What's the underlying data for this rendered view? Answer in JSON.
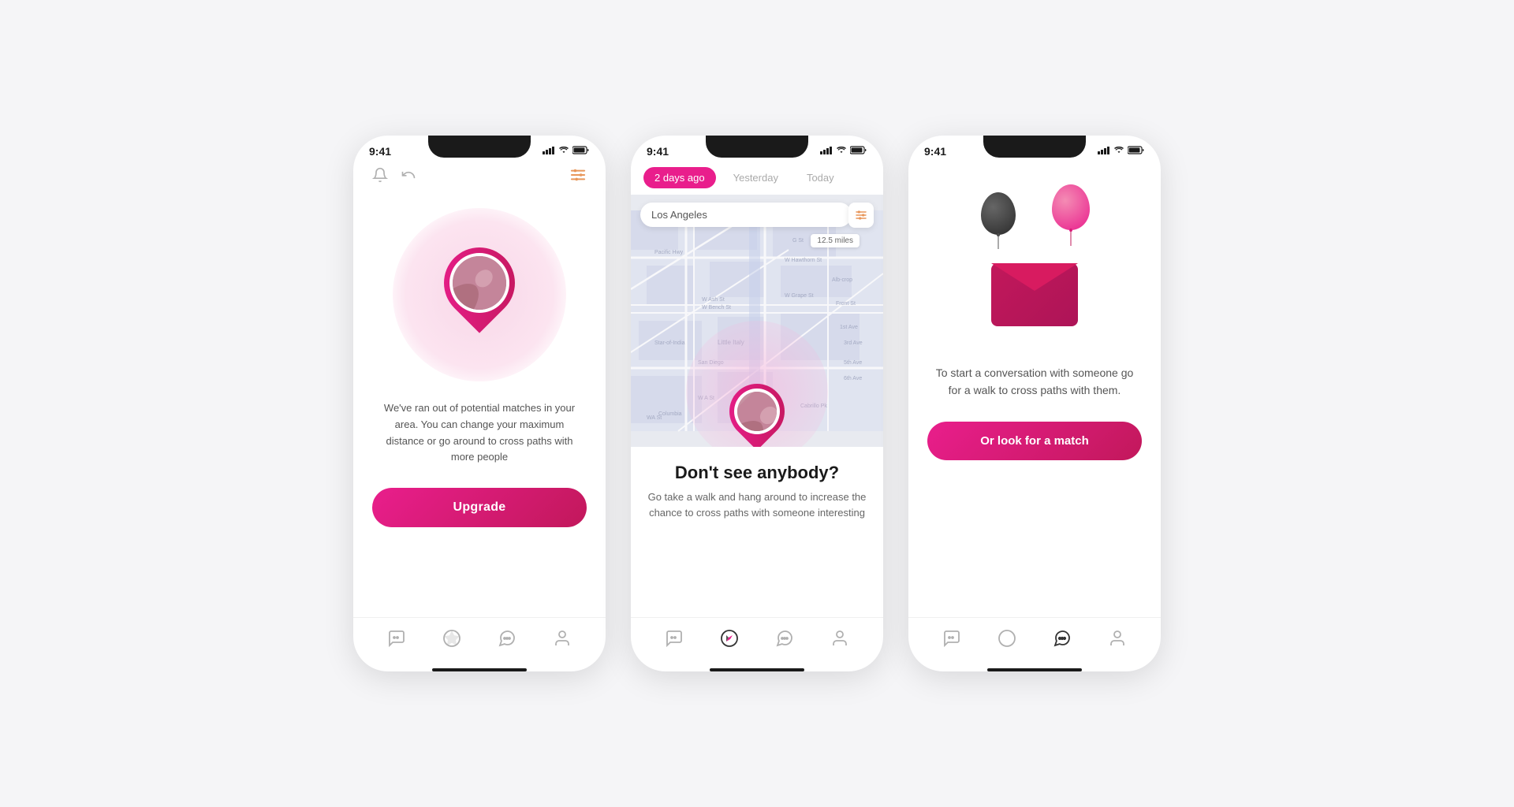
{
  "phones": [
    {
      "id": "phone1",
      "statusBar": {
        "time": "9:41",
        "signal": "▲▲▲",
        "wifi": "wifi",
        "battery": "battery"
      },
      "toolbar": {
        "bell": "🔔",
        "undo": "↩",
        "filter": "≡"
      },
      "noMatchText": "We've ran out of potential matches in your area. You can change your maximum distance or go around to cross paths with more people",
      "upgradeButton": "Upgrade",
      "bottomNav": [
        "chat",
        "compass",
        "message",
        "profile"
      ]
    },
    {
      "id": "phone2",
      "statusBar": {
        "time": "9:41"
      },
      "tabs": [
        "2 days ago",
        "Yesterday",
        "Today"
      ],
      "activeTab": 0,
      "mapSearch": "Los Angeles",
      "distance": "12.5 miles",
      "dontSeeTitle": "Don't see anybody?",
      "dontSeeText": "Go take a walk and hang around to increase the chance to cross paths with someone interesting",
      "bottomNav": [
        "chat",
        "compass",
        "message",
        "profile"
      ]
    },
    {
      "id": "phone3",
      "statusBar": {
        "time": "9:41"
      },
      "conversationText": "To start a conversation with someone go for a walk to cross paths with them.",
      "matchButton": "Or look for a match",
      "bottomNav": [
        "chat",
        "compass",
        "message",
        "profile"
      ]
    }
  ],
  "colors": {
    "accent": "#e91e8c",
    "accentDark": "#c2185b",
    "orange": "#e8965a",
    "gray": "#b0b0b0",
    "darkGray": "#333",
    "textPrimary": "#1a1a1a",
    "textSecondary": "#555"
  }
}
